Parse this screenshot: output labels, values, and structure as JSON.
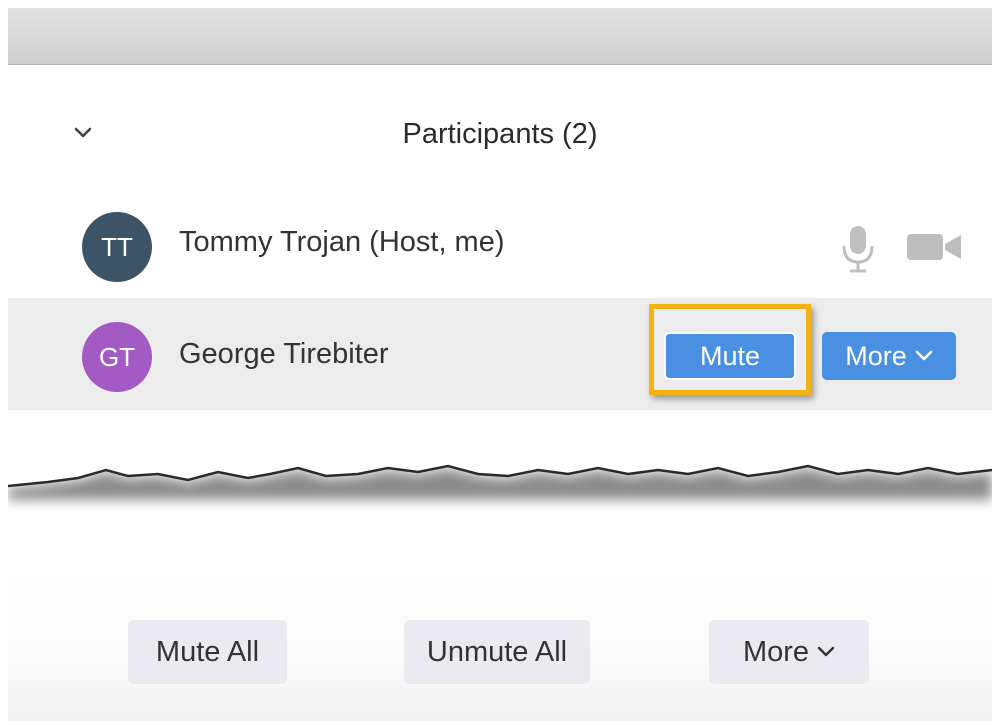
{
  "panel": {
    "title": "Participants (2)"
  },
  "participants": [
    {
      "initials": "TT",
      "name": "Tommy Trojan (Host, me)",
      "avatar_color": "#3d5366"
    },
    {
      "initials": "GT",
      "name": "George Tirebiter",
      "avatar_color": "#a35ac4"
    }
  ],
  "row_actions": {
    "mute_label": "Mute",
    "more_label": "More"
  },
  "footer": {
    "mute_all_label": "Mute All",
    "unmute_all_label": "Unmute All",
    "more_label": "More"
  },
  "colors": {
    "accent_blue": "#4a90e2",
    "highlight": "#f2b311",
    "selected_row": "#ececec"
  },
  "icons": [
    "chevron-down-icon",
    "microphone-icon",
    "video-camera-icon"
  ]
}
